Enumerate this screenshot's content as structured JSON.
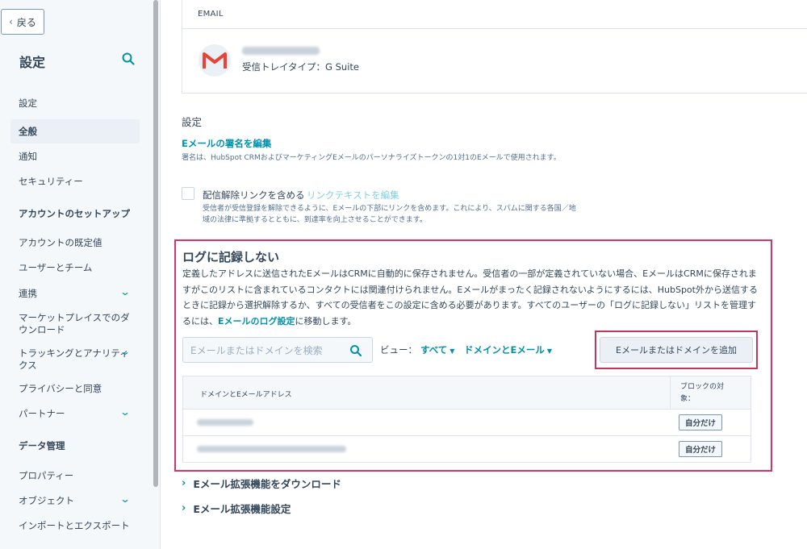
{
  "sidebar": {
    "back_label": "戻る",
    "title": "設定",
    "items": [
      {
        "label": "設定",
        "type": "heading"
      },
      {
        "label": "全般",
        "type": "item",
        "active": true
      },
      {
        "label": "通知",
        "type": "item"
      },
      {
        "label": "セキュリティー",
        "type": "item"
      },
      {
        "label": "アカウントのセットアップ",
        "type": "heading"
      },
      {
        "label": "アカウントの既定値",
        "type": "item"
      },
      {
        "label": "ユーザーとチーム",
        "type": "item"
      },
      {
        "label": "連携",
        "type": "item",
        "expandable": true
      },
      {
        "label": "マーケットプレイスでのダ",
        "label2": "ウンロード",
        "type": "item"
      },
      {
        "label": "トラッキングとアナリティ",
        "label2": "クス",
        "type": "item",
        "expandable": true
      },
      {
        "label": "プライバシーと同意",
        "type": "item"
      },
      {
        "label": "パートナー",
        "type": "item",
        "expandable": true
      },
      {
        "label": "データ管理",
        "type": "heading"
      },
      {
        "label": "プロパティー",
        "type": "item"
      },
      {
        "label": "オブジェクト",
        "type": "item",
        "expandable": true
      },
      {
        "label": "インポートとエクスポート",
        "type": "item"
      }
    ]
  },
  "email_card": {
    "header": "EMAIL",
    "inbox_type": "受信トレイタイプ：G Suite"
  },
  "settings": {
    "title": "設定",
    "signature_link": "Eメールの署名を編集",
    "signature_desc": "署名は、HubSpot CRMおよびマーケティングEメールのパーソナライズトークンの1対1のEメールで使用されます。",
    "unsubscribe_label": "配信解除リンクを含める",
    "unsubscribe_edit": "リンクテキストを編集",
    "unsubscribe_desc": "受信者が受信登録を解除できるように、Eメールの下部にリンクを含めます。これにより、スパムに関する各国／地域の法律に準拠するとともに、到達率を向上させることができます。"
  },
  "no_log": {
    "title": "ログに記録しない",
    "desc_1": "定義したアドレスに送信されたEメールはCRMに自動的に保存されません。受信者の一部が定義されていない場合、EメールはCRMに保存されますがこのリストに含まれているコンタクトには関連付けられません。Eメールがまったく記録されないようにするには、HubSpot外から送信するときに記録から選択解除するか、すべての受信者をこの設定に含める必要があります。すべてのユーザーの「ログに記録しない」リストを管理するには、",
    "desc_link": "Eメールのログ設定",
    "desc_2": "に移動します。",
    "search_placeholder": "Eメールまたはドメインを検索",
    "view_label": "ビュー：",
    "view_filter_1": "すべて",
    "view_filter_2": "ドメインとEメール",
    "add_button": "Eメールまたはドメインを追加",
    "table": {
      "col_domain": "ドメインとEメールアドレス",
      "col_block": "ブロックの対象：",
      "rows": [
        {
          "block": "自分だけ"
        },
        {
          "block": "自分だけ"
        }
      ]
    }
  },
  "accordions": {
    "download": "Eメール拡張機能をダウンロード",
    "settings": "Eメール拡張機能設定"
  },
  "colors": {
    "accent": "#0091ae",
    "text": "#33475b",
    "highlight": "#d6326c",
    "gmail_red": "#ea4335"
  }
}
